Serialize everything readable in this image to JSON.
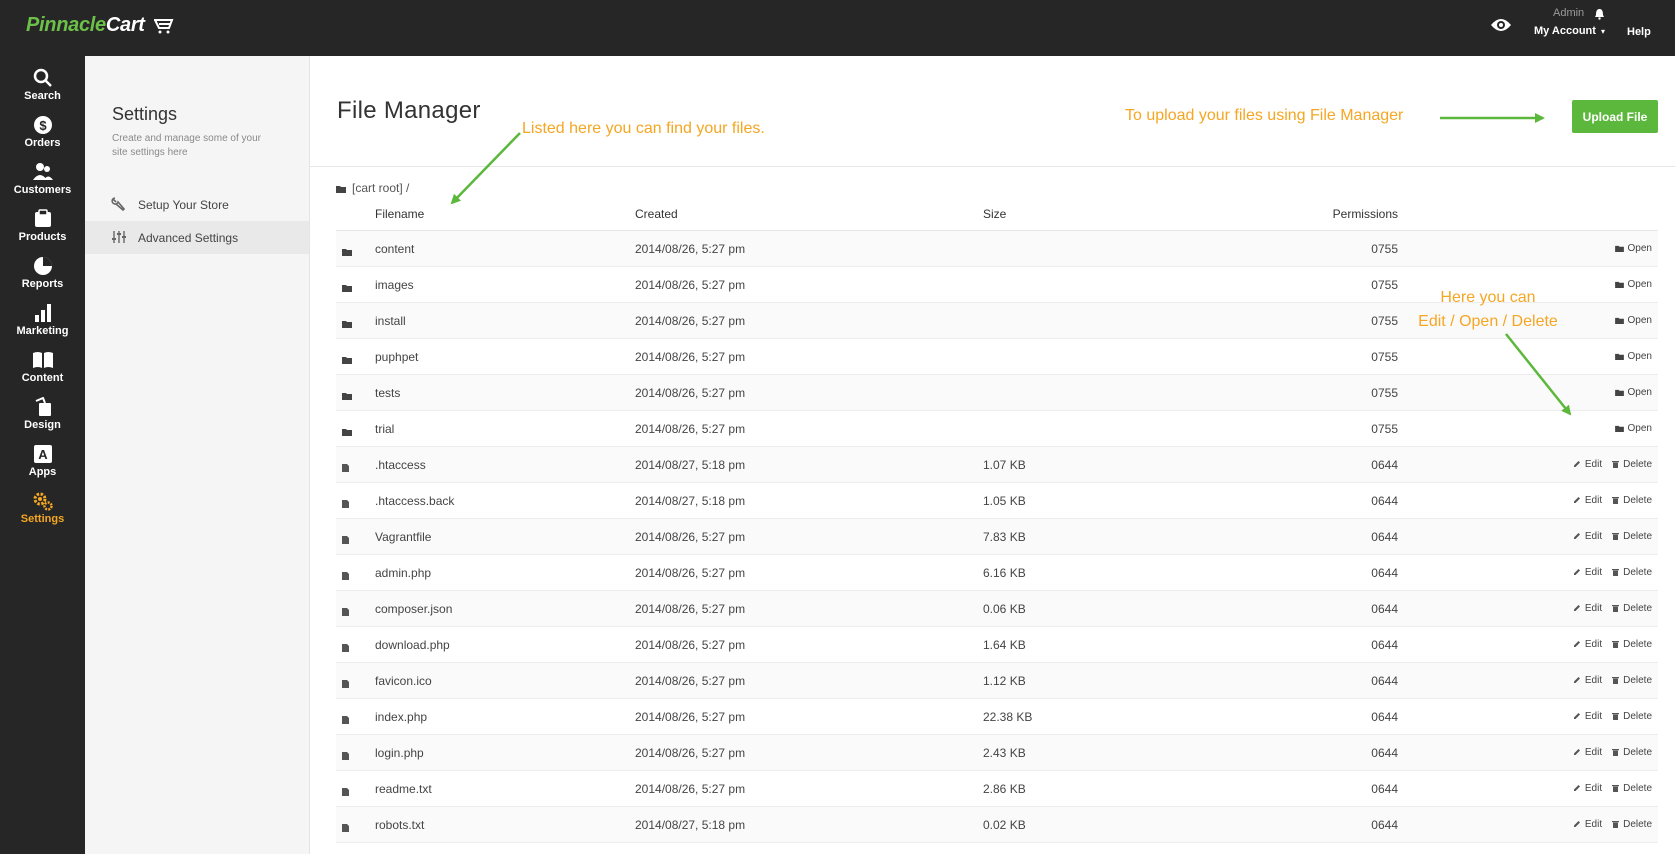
{
  "header": {
    "logo_part1": "Pinnacle",
    "logo_part2": "Cart",
    "admin_label": "Admin",
    "account_label": "My Account",
    "help_label": "Help"
  },
  "nav": [
    {
      "label": "Search",
      "icon": "search-icon"
    },
    {
      "label": "Orders",
      "icon": "dollar-icon"
    },
    {
      "label": "Customers",
      "icon": "users-icon"
    },
    {
      "label": "Products",
      "icon": "tag-icon"
    },
    {
      "label": "Reports",
      "icon": "pie-chart-icon"
    },
    {
      "label": "Marketing",
      "icon": "bar-chart-icon"
    },
    {
      "label": "Content",
      "icon": "book-icon"
    },
    {
      "label": "Design",
      "icon": "paint-bucket-icon"
    },
    {
      "label": "Apps",
      "icon": "app-icon"
    },
    {
      "label": "Settings",
      "icon": "gears-icon",
      "active": true
    }
  ],
  "subnav": {
    "title": "Settings",
    "description": "Create and manage some of your site settings here",
    "items": [
      {
        "label": "Setup Your Store",
        "icon": "wrench-icon"
      },
      {
        "label": "Advanced Settings",
        "icon": "sliders-icon",
        "active": true
      }
    ]
  },
  "main": {
    "title": "File Manager",
    "upload_label": "Upload File",
    "path": "[cart root] /",
    "columns": {
      "filename": "Filename",
      "created": "Created",
      "size": "Size",
      "permissions": "Permissions"
    },
    "actions": {
      "open": "Open",
      "edit": "Edit",
      "delete": "Delete"
    },
    "rows": [
      {
        "type": "folder",
        "name": "content",
        "created": "2014/08/26, 5:27 pm",
        "size": "",
        "perm": "0755"
      },
      {
        "type": "folder",
        "name": "images",
        "created": "2014/08/26, 5:27 pm",
        "size": "",
        "perm": "0755"
      },
      {
        "type": "folder",
        "name": "install",
        "created": "2014/08/26, 5:27 pm",
        "size": "",
        "perm": "0755"
      },
      {
        "type": "folder",
        "name": "puphpet",
        "created": "2014/08/26, 5:27 pm",
        "size": "",
        "perm": "0755"
      },
      {
        "type": "folder",
        "name": "tests",
        "created": "2014/08/26, 5:27 pm",
        "size": "",
        "perm": "0755"
      },
      {
        "type": "folder",
        "name": "trial",
        "created": "2014/08/26, 5:27 pm",
        "size": "",
        "perm": "0755"
      },
      {
        "type": "file",
        "name": ".htaccess",
        "created": "2014/08/27, 5:18 pm",
        "size": "1.07 KB",
        "perm": "0644"
      },
      {
        "type": "file",
        "name": ".htaccess.back",
        "created": "2014/08/27, 5:18 pm",
        "size": "1.05 KB",
        "perm": "0644"
      },
      {
        "type": "file",
        "name": "Vagrantfile",
        "created": "2014/08/26, 5:27 pm",
        "size": "7.83 KB",
        "perm": "0644"
      },
      {
        "type": "file",
        "name": "admin.php",
        "created": "2014/08/26, 5:27 pm",
        "size": "6.16 KB",
        "perm": "0644"
      },
      {
        "type": "file",
        "name": "composer.json",
        "created": "2014/08/26, 5:27 pm",
        "size": "0.06 KB",
        "perm": "0644"
      },
      {
        "type": "file",
        "name": "download.php",
        "created": "2014/08/26, 5:27 pm",
        "size": "1.64 KB",
        "perm": "0644"
      },
      {
        "type": "file",
        "name": "favicon.ico",
        "created": "2014/08/26, 5:27 pm",
        "size": "1.12 KB",
        "perm": "0644"
      },
      {
        "type": "file",
        "name": "index.php",
        "created": "2014/08/26, 5:27 pm",
        "size": "22.38 KB",
        "perm": "0644"
      },
      {
        "type": "file",
        "name": "login.php",
        "created": "2014/08/26, 5:27 pm",
        "size": "2.43 KB",
        "perm": "0644"
      },
      {
        "type": "file",
        "name": "readme.txt",
        "created": "2014/08/26, 5:27 pm",
        "size": "2.86 KB",
        "perm": "0644"
      },
      {
        "type": "file",
        "name": "robots.txt",
        "created": "2014/08/27, 5:18 pm",
        "size": "0.02 KB",
        "perm": "0644"
      }
    ]
  },
  "annotations": {
    "files": "Listed here you can find your files.",
    "upload": "To upload your files using File Manager",
    "actions_line1": "Here you can",
    "actions_line2": "Edit / Open / Delete"
  },
  "colors": {
    "brand_green": "#6cc04a",
    "upload_green": "#5cb83c",
    "annotation_orange": "#f5a623",
    "sidebar_dark": "#262626"
  }
}
